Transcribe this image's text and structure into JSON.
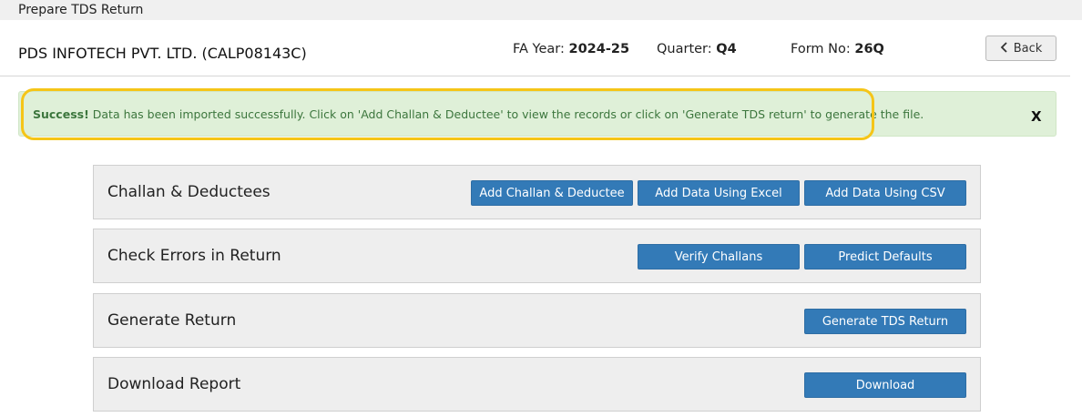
{
  "window": {
    "title": "Prepare TDS Return"
  },
  "header": {
    "company": "PDS INFOTECH PVT. LTD. (CALP08143C)",
    "fa_year_label": "FA Year: ",
    "fa_year_value": "2024-25",
    "quarter_label": "Quarter: ",
    "quarter_value": "Q4",
    "form_label": "Form No: ",
    "form_value": "26Q",
    "back_label": "Back"
  },
  "alert": {
    "strong": "Success!",
    "message": " Data has been imported successfully. Click on 'Add Challan & Deductee' to view the records or click on 'Generate TDS return' to generate the file.",
    "close": "X",
    "highlight_color": "#f5c518",
    "background": "#dff0d8"
  },
  "sections": {
    "challan": {
      "title": "Challan & Deductees",
      "add_challan": "Add Challan & Deductee",
      "excel": "Add Data Using Excel",
      "csv": "Add Data Using CSV"
    },
    "errors": {
      "title": "Check Errors in Return",
      "verify": "Verify Challans",
      "predict": "Predict Defaults"
    },
    "generate": {
      "title": "Generate Return",
      "generate_btn": "Generate TDS Return"
    },
    "download": {
      "title": "Download Report",
      "download_btn": "Download"
    }
  },
  "colors": {
    "primary_button": "#337ab7"
  },
  "icons": {
    "back": "chevron-left-icon"
  }
}
